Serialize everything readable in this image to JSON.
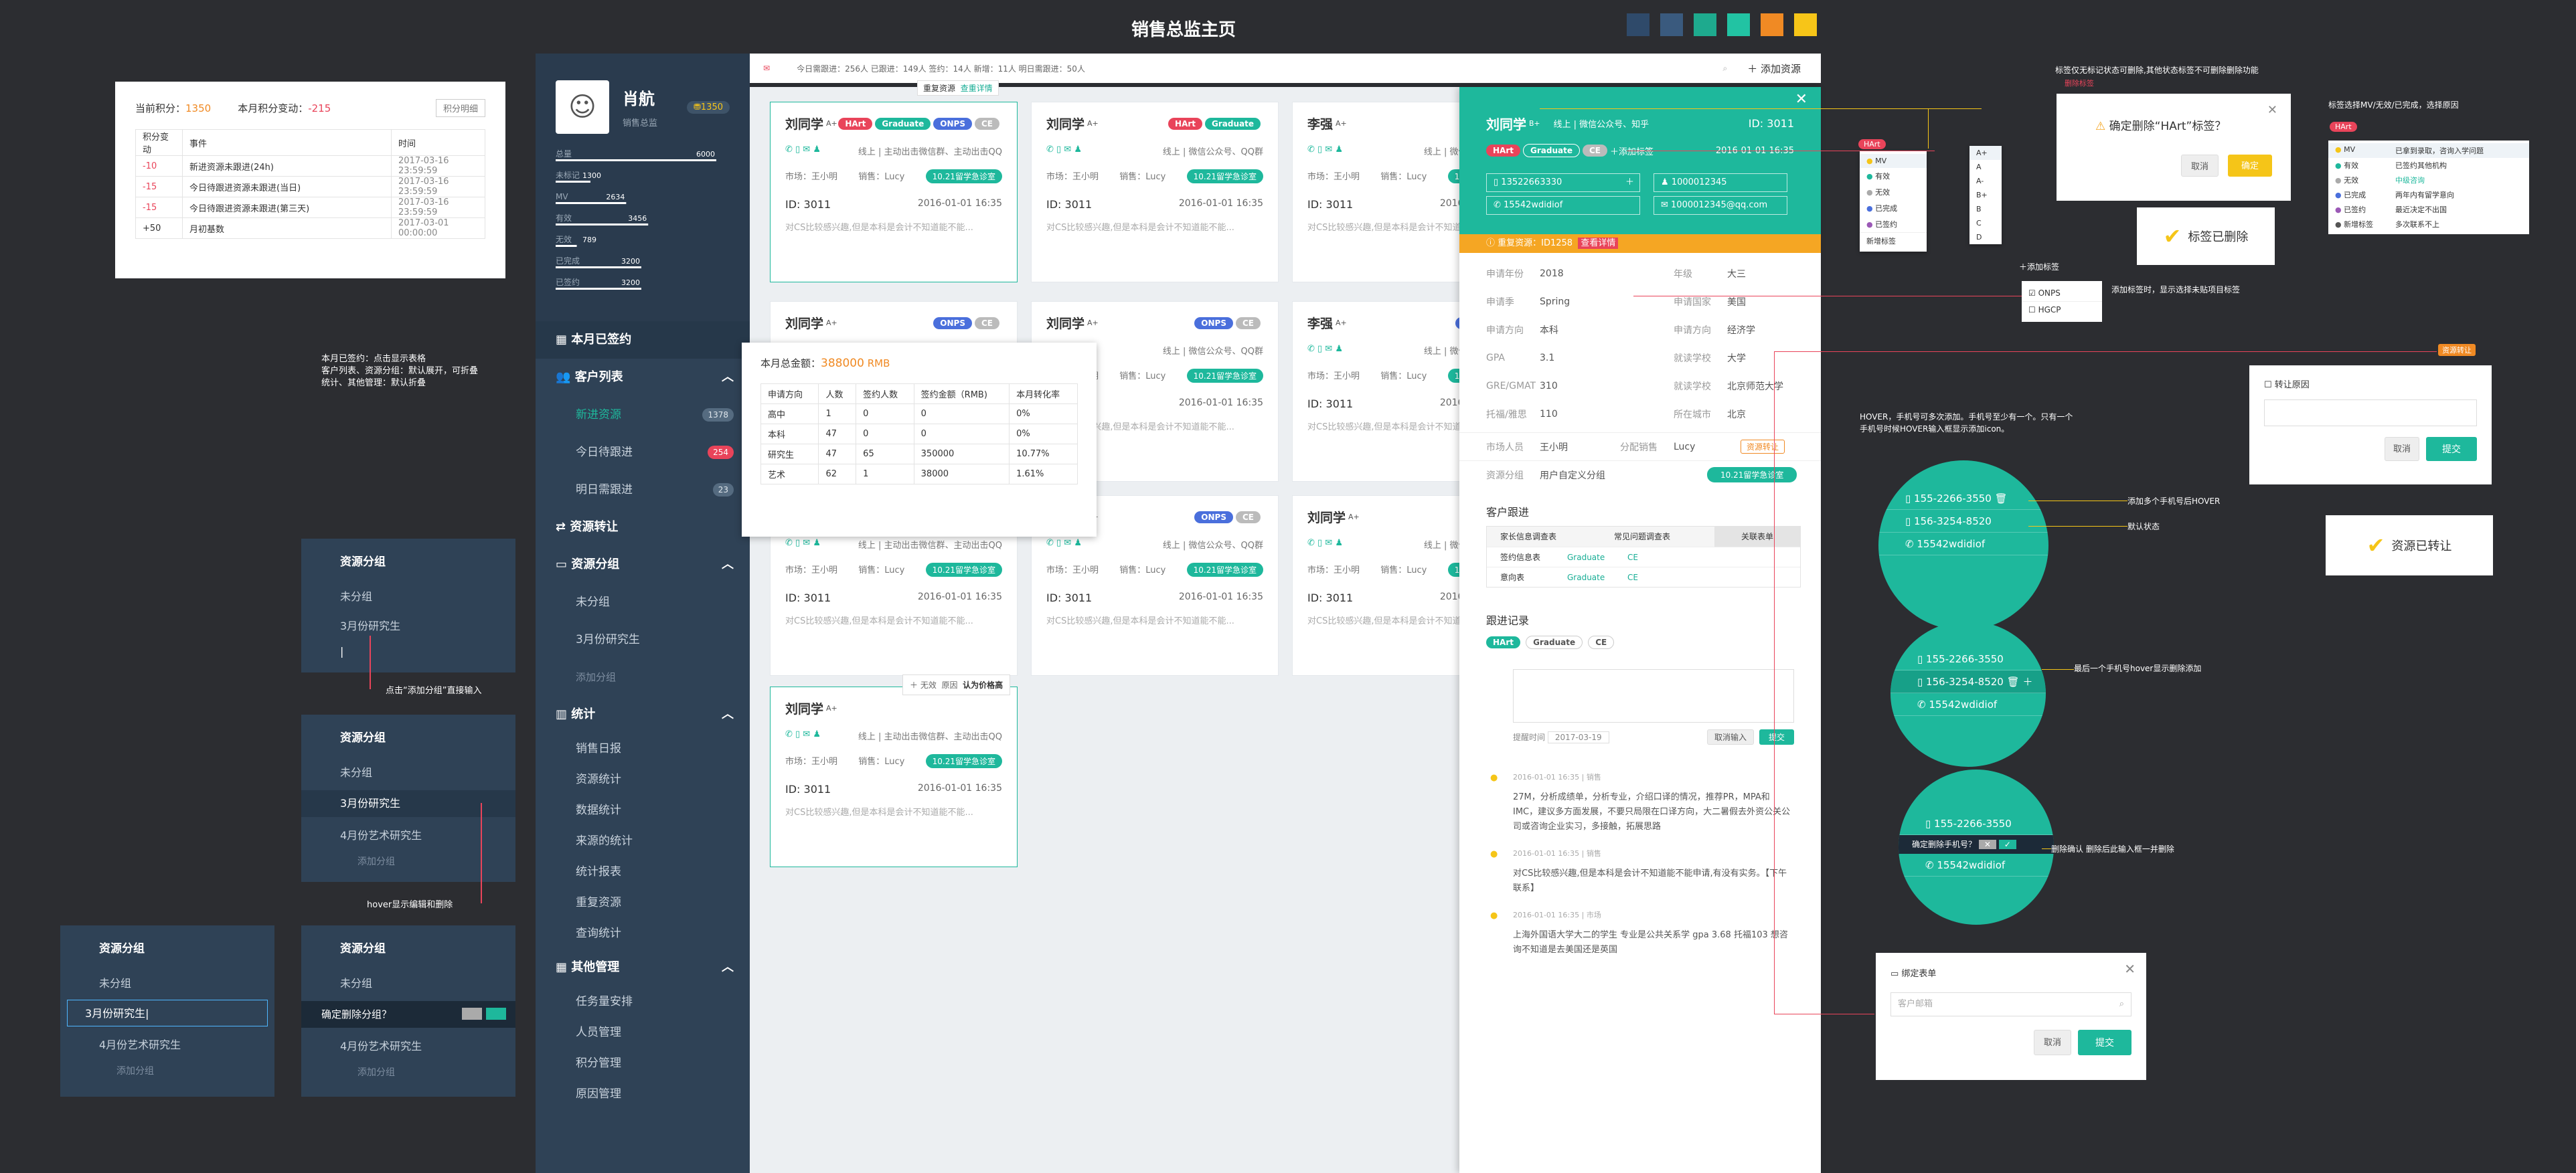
{
  "page_title": "销售总监主页",
  "palette": [
    "#2f4a6a",
    "#3a5a7e",
    "#1eaa8e",
    "#22c3a3",
    "#f08a24",
    "#f7c518"
  ],
  "points_panel": {
    "current_label": "当前积分：",
    "current_value": "1350",
    "month_label": "本月积分变动：",
    "month_value": "-215",
    "detail_button": "积分明细",
    "headers": [
      "积分变动",
      "事件",
      "时间"
    ],
    "rows": [
      [
        "-10",
        "新进资源未跟进(24h)",
        "2017-03-16  23:59:59"
      ],
      [
        "-15",
        "今日待跟进资源未跟进(当日)",
        "2017-03-16  23:59:59"
      ],
      [
        "-15",
        "今日待跟进资源未跟进(第三天)",
        "2017-03-16  23:59:59"
      ],
      [
        "+50",
        "月初基数",
        "2017-03-01  00:00:00"
      ]
    ]
  },
  "anno_left": [
    "本月已签约：点击显示表格",
    "客户列表、资源分组：默认展开，可折叠",
    "统计、其他管理：默认折叠"
  ],
  "group_panel_a": {
    "title": "资源分组",
    "items": [
      "未分组",
      "3月份研究生"
    ],
    "input_value": "|",
    "note": "点击“添加分组”直接输入"
  },
  "group_panel_b": {
    "title": "资源分组",
    "items": [
      "未分组",
      "3月份研究生",
      "4月份艺术研究生"
    ],
    "add": "添加分组",
    "note": "hover显示编辑和删除"
  },
  "group_panel_c": {
    "title": "资源分组",
    "items": [
      "未分组",
      "3月份研究生|",
      "4月份艺术研究生"
    ],
    "add": "添加分组"
  },
  "group_panel_d": {
    "title": "资源分组",
    "items": [
      "未分组",
      "确定删除分组？",
      "4月份艺术研究生"
    ],
    "add": "添加分组"
  },
  "profile": {
    "name": "肖航",
    "role": "销售总监",
    "points": "1350",
    "stats": [
      {
        "label": "总量",
        "value": "6000"
      },
      {
        "label": "未标记",
        "value": "1300"
      },
      {
        "label": "MV",
        "value": "2634"
      },
      {
        "label": "有效",
        "value": "3456"
      },
      {
        "label": "无效",
        "value": "789"
      },
      {
        "label": "已完成",
        "value": "3200"
      },
      {
        "label": "已签约",
        "value": "3200"
      }
    ]
  },
  "sidebar": {
    "signed": "本月已签约",
    "customer_list": "客户列表",
    "new_res": "新进资源",
    "new_res_count": "1378",
    "today": "今日待跟进",
    "today_count": "254",
    "tomorrow": "明日需跟进",
    "tomorrow_count": "23",
    "transfer": "资源转让",
    "groups": "资源分组",
    "g1": "未分组",
    "g2": "3月份研究生",
    "g_add": "添加分组",
    "stats": "统计",
    "s_items": [
      "销售日报",
      "资源统计",
      "数据统计",
      "来源的统计",
      "统计报表",
      "重复资源",
      "查询统计"
    ],
    "other": "其他管理",
    "o_items": [
      "任务量安排",
      "人员管理",
      "积分管理",
      "原因管理"
    ]
  },
  "topbar": {
    "text": "今日需跟进：256人  已跟进：149人  签约：14人  新增：11人  明日需跟进：50人",
    "tab1": "重复资源",
    "tab2": "查重详情",
    "add": "添加资源"
  },
  "signed_popup": {
    "label": "本月总金额：",
    "amount": "388000",
    "unit": "RMB",
    "headers": [
      "申请方向",
      "人数",
      "签约人数",
      "签约金额（RMB)",
      "本月转化率"
    ],
    "rows": [
      [
        "高中",
        "1",
        "0",
        "0",
        "0%"
      ],
      [
        "本科",
        "47",
        "0",
        "0",
        "0%"
      ],
      [
        "研究生",
        "47",
        "65",
        "350000",
        "10.77%"
      ],
      [
        "艺术",
        "62",
        "1",
        "38000",
        "1.61%"
      ]
    ]
  },
  "card": {
    "name": "刘同学",
    "grade": "A+",
    "source": "线上 | 主动出击微信群、主动出击QQ",
    "market": "市场：王小明",
    "sales": "销售：Lucy",
    "tag": "10.21留学急诊室",
    "id": "ID: 3011",
    "date": "2016-01-01 16:35",
    "desc": "对CS比较感兴趣,但是本科是会计不知道能不能..."
  },
  "card2": {
    "name": "李强",
    "source2": "线上 | 微信公众号、QQ群"
  },
  "tags": {
    "hart": "HArt",
    "grad": "Graduate",
    "onps": "ONPS",
    "ce": "CE"
  },
  "hover_pop": {
    "a": "无效",
    "b": "原因",
    "c": "认为价格高"
  },
  "detail": {
    "name": "刘同学",
    "grade": "B+",
    "channel": "线上 | 微信公众号、知乎",
    "id": "ID: 3011",
    "add_tag": "添加标签",
    "date": "2016-01-01 16:35",
    "phone": "13522663330",
    "qq": "1000012345",
    "wechat": "15542wdidiof",
    "email": "1000012345@qq.com",
    "repeat": "重复资源：ID1258",
    "view": "查看详情",
    "fields": [
      [
        "申请年份",
        "2018",
        "年级",
        "大三"
      ],
      [
        "申请季",
        "Spring",
        "申请国家",
        "美国"
      ],
      [
        "申请方向",
        "本科",
        "申请方向",
        "经济学"
      ],
      [
        "GPA",
        "3.1",
        "就读学校",
        "大学"
      ],
      [
        "GRE/GMAT",
        "310",
        "就读学校",
        "北京师范大学"
      ],
      [
        "托福/雅思",
        "110",
        "所在城市",
        "北京"
      ]
    ],
    "market_person": "市场人员",
    "market_val": "王小明",
    "assign": "分配销售",
    "assign_val": "Lucy",
    "transfer_btn": "资源转让",
    "group_lbl": "资源分组",
    "group_val": "用户自定义分组",
    "group_tag": "10.21留学急诊室",
    "follow_title": "客户跟进",
    "f_tabs": [
      "家长信息调查表",
      "常见问题调查表",
      "关联表单"
    ],
    "f_rows": [
      [
        "签约信息表",
        "Graduate",
        "CE"
      ],
      [
        "意向表",
        "Graduate",
        "CE"
      ]
    ],
    "log_title": "跟进记录",
    "log_tags": [
      "HArt",
      "Graduate",
      "CE"
    ],
    "log_date_lbl": "提醒时间",
    "log_date": "2017-03-19",
    "cancel": "取消输入",
    "submit": "提交",
    "logs": [
      {
        "meta": "2016-01-01 16:35 | 销售",
        "text": "27M，分析成绩单，分析专业，介绍口译的情况，推荐PR，MPA和IMC，建议多方面发展，不要只局限在口译方向，大二暑假去外资公关公司或咨询企业实习，多接触，拓展思路"
      },
      {
        "meta": "2016-01-01 16:35 | 销售",
        "text": "对CS比较感兴趣,但是本科是会计不知道能不能申请,有没有实务。【下午联系】"
      },
      {
        "meta": "2016-01-01 16:35 | 市场",
        "text": "上海外国语大学大二的学生 专业是公共关系学 gpa 3.68 托福103 想咨询不知道是去美国还是英国"
      }
    ]
  },
  "label_dd": {
    "items": [
      "MV",
      "有效",
      "无效",
      "已完成",
      "已签约",
      "新增标签"
    ]
  },
  "grade_dd": {
    "items": [
      "A+",
      "A",
      "A-",
      "B+",
      "B",
      "C",
      "D"
    ]
  },
  "tag_add": {
    "title": "添加标签",
    "o1": "ONPS",
    "o2": "HGCP",
    "note": "添加标签时，显示选择未贴项目标签"
  },
  "anno_top": {
    "a": "标签仅无标记状态可删除,其他状态标签不可删除删除功能",
    "b": "删除标签",
    "c": "标签选择MV/无效/已完成，选择原因"
  },
  "confirm_tag": {
    "text": "确定删除“HArt”标签？",
    "cancel": "取消",
    "ok": "确定"
  },
  "deleted_toast": "标签已删除",
  "reason_dd": {
    "tag": "HArt",
    "rows": [
      [
        "MV",
        "已拿到录取，咨询入学问题"
      ],
      [
        "有效",
        "已签约其他机构"
      ],
      [
        "无效",
        "中级咨询"
      ],
      [
        "已完成",
        "两年内有留学意向"
      ],
      [
        "已签约",
        "最近决定不出国"
      ],
      [
        "新增标签",
        "多次联系不上"
      ]
    ]
  },
  "transfer": {
    "tag": "资源转让",
    "title": "转让原因",
    "cancel": "取消",
    "ok": "提交",
    "toast": "资源已转让"
  },
  "phones": {
    "p1": "155-2266-3550",
    "p2": "156-3254-8520",
    "wx": "15542wdidiof",
    "confirm": "确定删除手机号？"
  },
  "anno_right": {
    "hover": "HOVER，手机号可多次添加。手机号至少有一个。只有一个手机号时候HOVER输入框显示添加icon。",
    "add_more": "添加多个手机号后HOVER",
    "default": "默认状态",
    "last": "最后一个手机号hover显示删除添加",
    "del": "删除确认  删除后此输入框一并删除"
  },
  "bind": {
    "title": "绑定表单",
    "placeholder": "客户邮箱",
    "cancel": "取消",
    "ok": "提交"
  }
}
